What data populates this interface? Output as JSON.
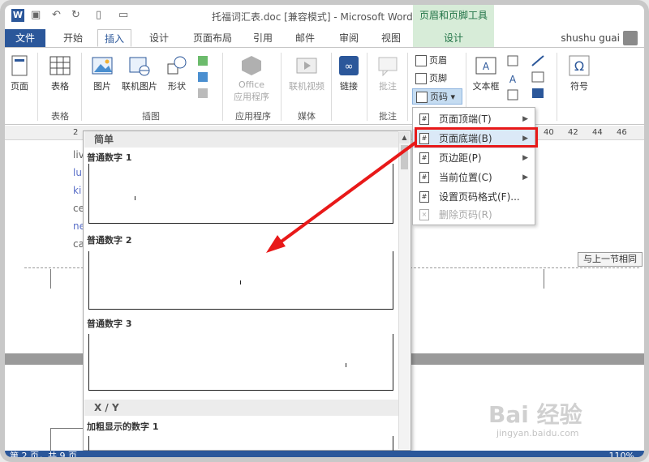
{
  "titlebar": {
    "title": "托福词汇表.doc [兼容模式] - Microsoft Word",
    "context_tools": "页眉和页脚工具",
    "app_icon": "W",
    "qa_icons": [
      "save-icon",
      "undo-icon",
      "redo-icon",
      "new-doc-icon",
      "open-icon"
    ]
  },
  "tabs": {
    "file": "文件",
    "items": [
      "开始",
      "插入",
      "设计",
      "页面布局",
      "引用",
      "邮件",
      "审阅",
      "视图"
    ],
    "context": "设计",
    "user": "shushu guai"
  },
  "ribbon": {
    "pages_label": "页面",
    "table_label": "表格",
    "table_group": "表格",
    "picture": "图片",
    "online_picture": "联机图片",
    "shapes": "形状",
    "illus_group": "插图",
    "office_apps_1": "Office",
    "office_apps_2": "应用程序",
    "apps_group": "应用程序",
    "online_video": "联机视频",
    "media_group": "媒体",
    "link": "链接",
    "comment": "批注",
    "comment_group": "批注",
    "header": "页眉",
    "footer": "页脚",
    "page_number": "页码",
    "textbox": "文本框",
    "symbol": "符号"
  },
  "ruler": {
    "left_tick": "2",
    "right_ticks": [
      "40",
      "42",
      "44",
      "46"
    ]
  },
  "document": {
    "lines": [
      "liv",
      "lu",
      "ki",
      "ce",
      "ne",
      "ca"
    ],
    "same_as_previous": "与上一节相同"
  },
  "gallery": {
    "section_simple": "简单",
    "items": [
      {
        "label": "普通数字 1"
      },
      {
        "label": "普通数字 2"
      },
      {
        "label": "普通数字 3"
      }
    ],
    "section_xy": "X / Y",
    "bold_item": "加粗显示的数字 1"
  },
  "submenu": {
    "items": [
      {
        "label": "页面顶端(T)",
        "arrow": "▶"
      },
      {
        "label": "页面底端(B)",
        "arrow": "▶"
      },
      {
        "label": "页边距(P)",
        "arrow": "▶"
      },
      {
        "label": "当前位置(C)",
        "arrow": "▶"
      },
      {
        "label": "设置页码格式(F)...",
        "arrow": ""
      },
      {
        "label": "删除页码(R)",
        "arrow": ""
      }
    ]
  },
  "statusbar": {
    "page_info": "第 2 页，共 9 页",
    "zoom": "110%"
  },
  "watermark": {
    "main": "Bai 经验",
    "sub": "jingyan.baidu.com"
  },
  "colors": {
    "accent": "#2b579a",
    "context_tab": "#d7ecd8",
    "highlight": "#e81919"
  }
}
